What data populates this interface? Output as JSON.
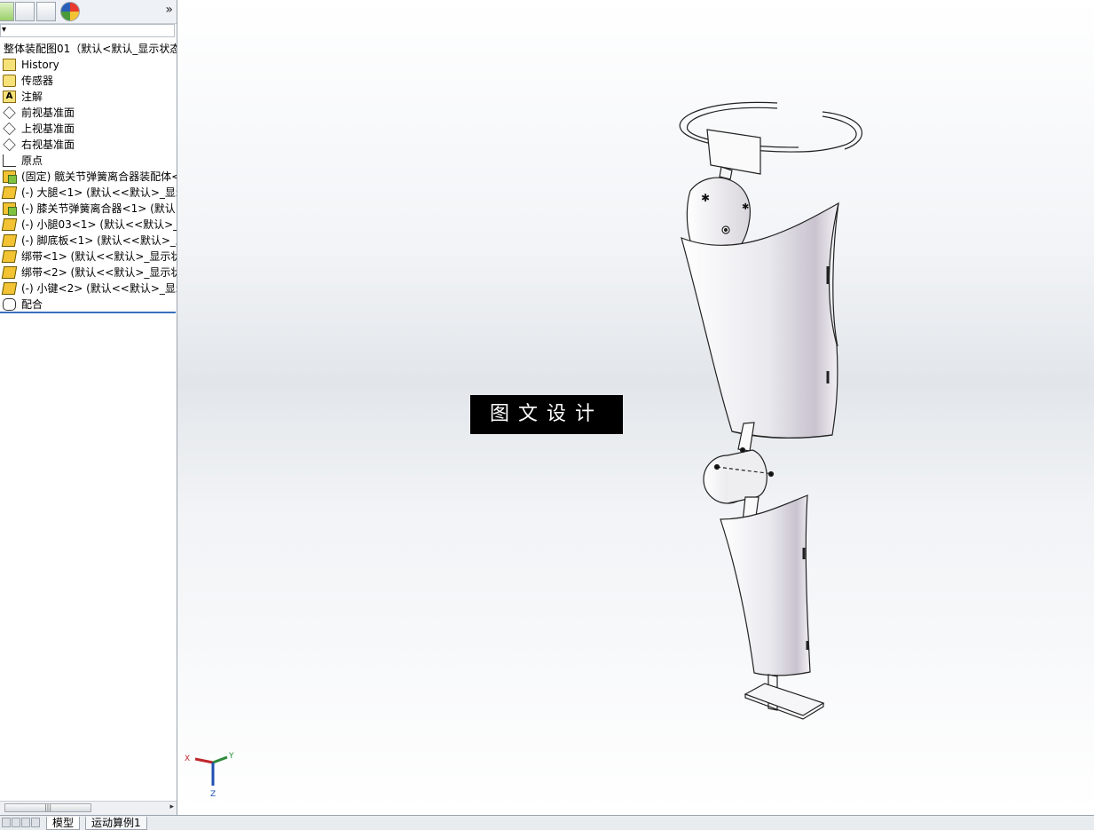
{
  "tree": {
    "root_label": "整体装配图01（默认<默认_显示状态",
    "items": [
      {
        "label": "History",
        "icon": "history-folder-icon"
      },
      {
        "label": "传感器",
        "icon": "sensors-folder-icon"
      },
      {
        "label": "注解",
        "icon": "annotations-folder-icon"
      },
      {
        "label": "前视基准面",
        "icon": "plane-icon"
      },
      {
        "label": "上视基准面",
        "icon": "plane-icon"
      },
      {
        "label": "右视基准面",
        "icon": "plane-icon"
      },
      {
        "label": "原点",
        "icon": "origin-icon"
      },
      {
        "label": "(固定) 髋关节弹簧离合器装配体<",
        "icon": "subassembly-icon"
      },
      {
        "label": "(-) 大腿<1> (默认<<默认>_显示",
        "icon": "part-icon"
      },
      {
        "label": "(-) 膝关节弹簧离合器<1> (默认<",
        "icon": "subassembly-icon"
      },
      {
        "label": "(-) 小腿03<1> (默认<<默认>_显",
        "icon": "part-icon"
      },
      {
        "label": "(-) 脚底板<1> (默认<<默认>_显",
        "icon": "part-icon"
      },
      {
        "label": "绑带<1> (默认<<默认>_显示状",
        "icon": "part-icon"
      },
      {
        "label": "绑带<2> (默认<<默认>_显示状",
        "icon": "part-icon"
      },
      {
        "label": "(-) 小键<2> (默认<<默认>_显示",
        "icon": "part-icon"
      },
      {
        "label": "配合",
        "icon": "mates-icon"
      }
    ]
  },
  "tabs": {
    "model": "模型",
    "motion": "运动算例1"
  },
  "watermark": "图文设计",
  "triad": {
    "x": "X",
    "y": "Y",
    "z": "Z"
  },
  "colors": {
    "triad_x": "#c0272d",
    "triad_y": "#2e8b3a",
    "triad_z": "#1f4fb0",
    "selection_line": "#3a6fbd"
  }
}
